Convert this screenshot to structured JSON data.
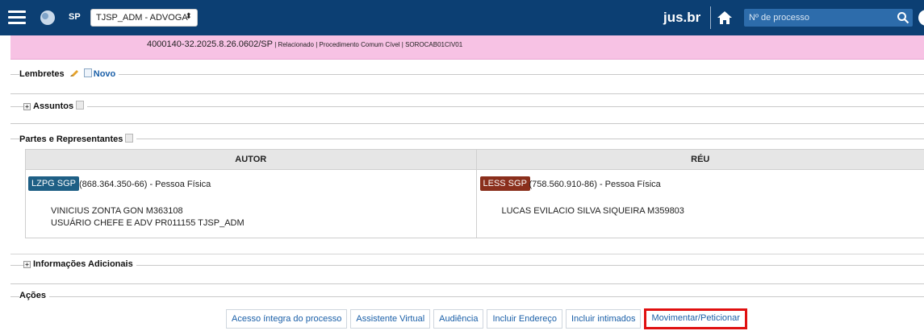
{
  "header": {
    "state": "SP",
    "profile_select": "TJSP_ADM - ADVOGA",
    "brand": "jus.br",
    "search_placeholder": "Nº de processo"
  },
  "banner": {
    "process_number": "4000140-32.2025.8.26.0602/SP",
    "details": " | Relacionado | Procedimento Comum Cível | SOROCAB01CIV01"
  },
  "lembretes": {
    "title": "Lembretes",
    "new_link": "Novo"
  },
  "assuntos": {
    "title": "Assuntos"
  },
  "partes": {
    "title": "Partes e Representantes",
    "col_autor": "AUTOR",
    "col_reu": "RÉU",
    "autor": {
      "badge": "LZPG SGP",
      "doc": "(868.364.350-66) - Pessoa Física",
      "lawyer1": "VINICIUS ZONTA GON  M363108",
      "lawyer2": "USUÁRIO CHEFE E ADV  PR011155  TJSP_ADM"
    },
    "reu": {
      "badge": "LESS SGP",
      "doc": "(758.560.910-86) - Pessoa Física",
      "lawyer1": "LUCAS EVILACIO SILVA SIQUEIRA  M359803"
    }
  },
  "info_adicionais": {
    "title": "Informações Adicionais"
  },
  "acoes": {
    "title": "Ações",
    "buttons": [
      "Acesso íntegra do processo",
      "Assistente Virtual",
      "Audiência",
      "Incluir Endereço",
      "Incluir intimados",
      "Movimentar/Peticionar"
    ]
  },
  "colors": {
    "navbar": "#0c3f73",
    "banner": "#f7c2e4",
    "link": "#1a5fa8",
    "badge_autor": "#1e5f85",
    "badge_reu": "#8a2f1c",
    "highlight_border": "#e01010"
  }
}
